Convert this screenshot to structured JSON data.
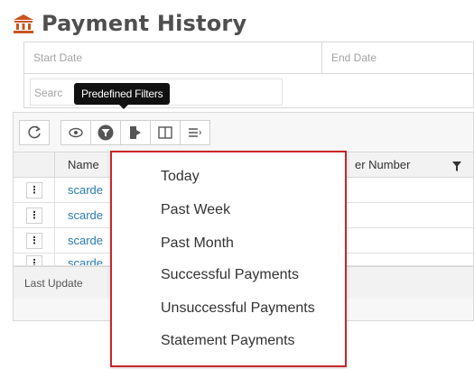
{
  "header": {
    "title": "Payment History",
    "icon": "bank-icon",
    "icon_color": "#c8551e"
  },
  "filters": {
    "start_date_placeholder": "Start Date",
    "end_date_placeholder": "End Date",
    "search_placeholder": "Searc"
  },
  "tooltip": {
    "text": "Predefined Filters"
  },
  "toolbar": {
    "buttons": [
      {
        "icon": "refresh-icon"
      },
      {
        "icon": "eye-icon"
      },
      {
        "icon": "filter-icon"
      },
      {
        "icon": "export-icon"
      },
      {
        "icon": "columns-icon"
      },
      {
        "icon": "list-settings-icon"
      }
    ]
  },
  "table": {
    "columns": [
      "Name",
      "er Number"
    ],
    "rows": [
      {
        "name": "scarde"
      },
      {
        "name": "scarde"
      },
      {
        "name": "scarde"
      },
      {
        "name": "scarde"
      }
    ],
    "footer": "Last Update"
  },
  "predefined_filters": {
    "items": [
      "Today",
      "Past Week",
      "Past Month",
      "Successful Payments",
      "Unsuccessful Payments",
      "Statement Payments"
    ],
    "highlight_color": "#c9262b"
  }
}
